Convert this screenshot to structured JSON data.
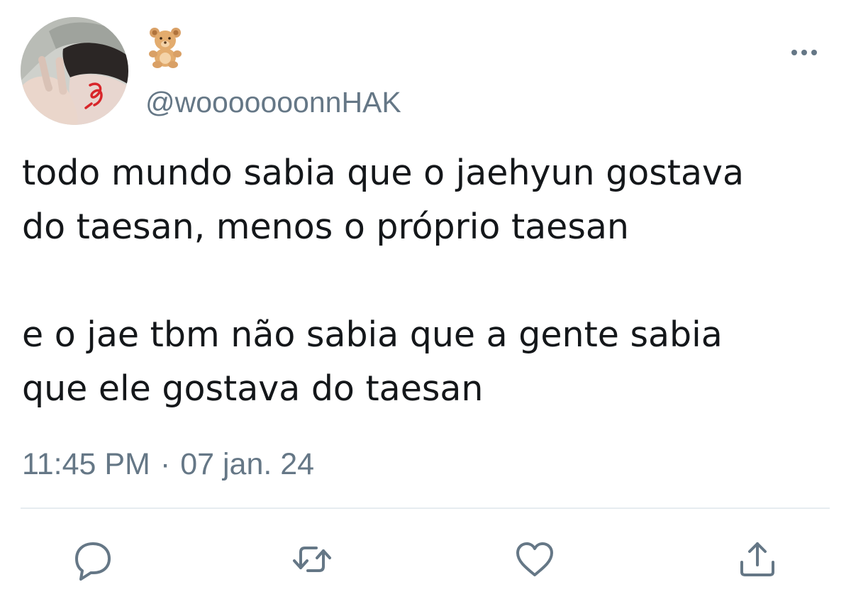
{
  "tweet": {
    "display_name": "🧸",
    "display_name_icon": "teddy-bear-icon",
    "handle": "@wooooooonnHAK",
    "text_paragraph_1": [
      "todo mundo sabia que o jaehyun gostava",
      "do taesan, menos o próprio taesan"
    ],
    "text_paragraph_2": [
      "e o jae tbm não sabia que a gente sabia",
      "que ele gostava do taesan"
    ],
    "time": "11:45 PM",
    "separator": "·",
    "date": "07 jan. 24"
  },
  "actions": {
    "reply_icon": "comment-bubble-icon",
    "retweet_icon": "retweet-arrows-icon",
    "like_icon": "heart-icon",
    "share_icon": "share-upload-icon",
    "more_icon": "ellipsis-icon"
  },
  "colors": {
    "text": "#14171a",
    "secondary": "#657786",
    "divider": "#e6ecf0"
  }
}
